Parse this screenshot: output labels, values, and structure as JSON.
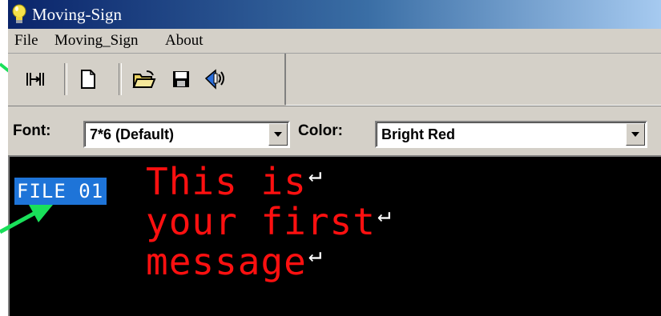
{
  "window": {
    "title": "Moving-Sign"
  },
  "menu": {
    "items": [
      "File",
      "Moving_Sign",
      "About"
    ]
  },
  "toolbar": {
    "buttons": [
      "connect-icon",
      "new-document-icon",
      "open-folder-icon",
      "save-disk-icon",
      "transmit-icon"
    ]
  },
  "font": {
    "label": "Font:",
    "value": "7*6 (Default)"
  },
  "color": {
    "label": "Color:",
    "value": "Bright Red"
  },
  "editor": {
    "file_label": "FILE 01",
    "lines": [
      "This is",
      "your first",
      "message"
    ],
    "return_symbol": "↵",
    "text_color": "#ff1010",
    "background": "#000000"
  },
  "colors": {
    "arrow": "#19e05a",
    "selection": "#1e74d8"
  }
}
